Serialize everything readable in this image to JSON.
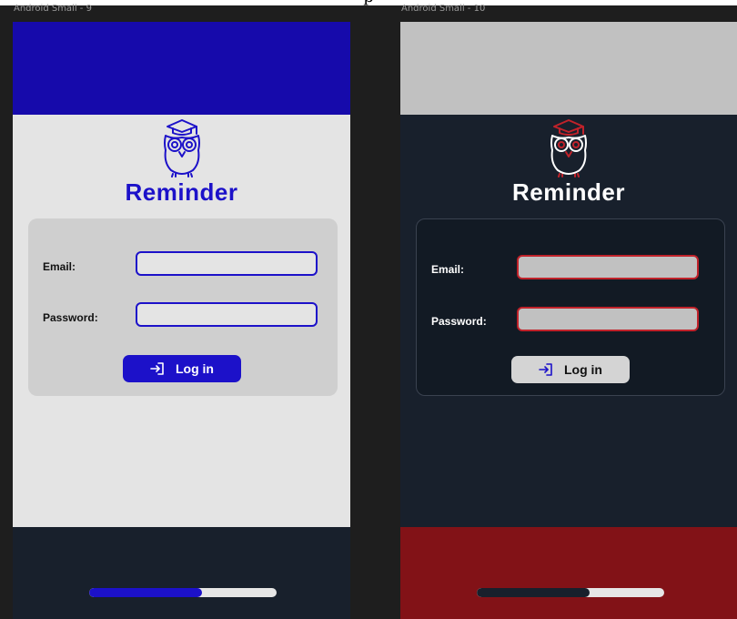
{
  "page": {
    "caption": "p"
  },
  "colors": {
    "left_primary": "#1c11c9",
    "left_header": "#160aab",
    "left_background": "#e4e4e4",
    "left_card": "#cfcfcf",
    "left_footer": "#18202c",
    "right_background": "#18202c",
    "right_header": "#c1c1c1",
    "right_card": "#121a24",
    "right_accent": "#c0222a",
    "right_footer": "#821217",
    "right_button": "#d4d4d4",
    "progress_track": "#e6e6e6"
  },
  "frames": [
    {
      "label": "Android Small - 9",
      "app_title": "Reminder",
      "email_label": "Email:",
      "email_value": "",
      "password_label": "Password:",
      "password_value": "",
      "login_label": "Log in",
      "login_icon": "login-arrow-icon",
      "logo_icon": "owl-graduate-icon",
      "progress": 0.6
    },
    {
      "label": "Android Small - 10",
      "app_title": "Reminder",
      "email_label": "Email:",
      "email_value": "",
      "password_label": "Password:",
      "password_value": "",
      "login_label": "Log in",
      "login_icon": "login-arrow-icon",
      "logo_icon": "owl-graduate-icon",
      "progress": 0.6
    }
  ]
}
